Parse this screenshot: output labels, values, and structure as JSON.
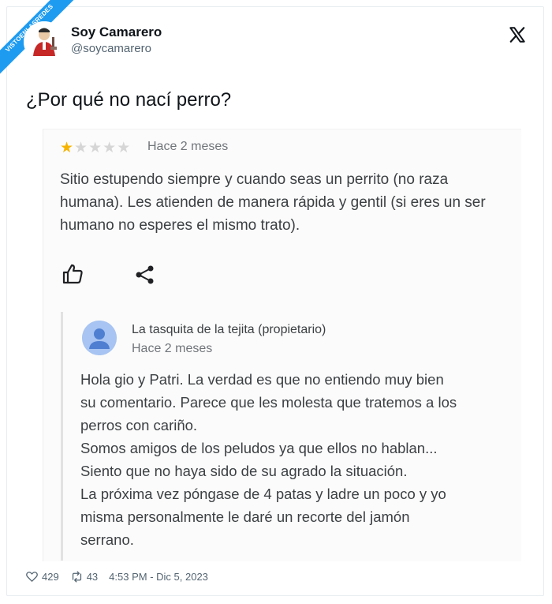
{
  "banner": {
    "line1": "VISTOENLASREDES",
    "line2": ".com"
  },
  "author": {
    "name": "Soy Camarero",
    "handle": "@soycamarero"
  },
  "tweet": {
    "text": "¿Por qué no nací perro?"
  },
  "review": {
    "rating": 1,
    "rating_max": 5,
    "date": "Hace 2 meses",
    "text": "Sitio estupendo siempre y cuando seas un perrito (no raza humana). Les atienden de manera rápida y gentil (si eres un ser humano no esperes el mismo trato).",
    "star_color": "#f6b400"
  },
  "reply": {
    "owner_name": "La tasquita de la tejita (propietario)",
    "date": "Hace 2 meses",
    "lines": [
      "Hola gio y Patri. La verdad es que no entiendo muy bien",
      "su comentario. Parece que les molesta que tratemos a los",
      "perros con cariño.",
      "Somos amigos de los peludos ya que ellos no hablan...",
      "Siento que no haya sido de su agrado la situación.",
      "La próxima vez póngase de 4 patas y ladre un poco y yo",
      "misma personalmente le daré un recorte del jamón",
      "serrano."
    ]
  },
  "footer": {
    "likes": "429",
    "retweets": "43",
    "timestamp": "4:53 PM - Dic 5, 2023"
  },
  "icons": [
    "x-logo-icon",
    "thumbs-up-icon",
    "share-icon",
    "person-icon",
    "heart-icon",
    "retweet-icon"
  ],
  "colors": {
    "accent": "#1d9bf0",
    "star": "#f6b400",
    "text": "#3c4043"
  }
}
